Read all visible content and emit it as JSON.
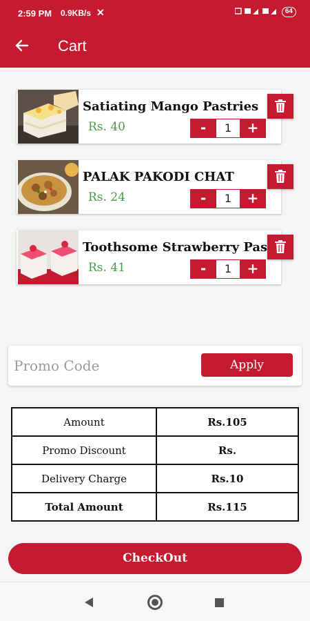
{
  "status_bar": {
    "time": "2:59 PM",
    "speed": "0.9KB/s",
    "battery": "64"
  },
  "app_bar": {
    "title": "Cart",
    "back_icon": "arrow-left-icon"
  },
  "cart": {
    "items": [
      {
        "name": "Satiating Mango Pastries",
        "price": "Rs. 40",
        "quantity": "1",
        "image": "mango-pastry-image"
      },
      {
        "name": "PALAK PAKODI CHAT",
        "price": "Rs. 24",
        "quantity": "1",
        "image": "palak-pakodi-image"
      },
      {
        "name": "Toothsome Strawberry Pastries",
        "price": "Rs. 41",
        "quantity": "1",
        "image": "strawberry-pastry-image"
      }
    ],
    "decrement_label": "-",
    "increment_label": "+",
    "delete_icon": "trash-icon"
  },
  "promo": {
    "placeholder": "Promo Code",
    "apply_label": "Apply"
  },
  "summary": {
    "rows": [
      {
        "label": "Amount",
        "value": "Rs.105"
      },
      {
        "label": "Promo Discount",
        "value": "Rs."
      },
      {
        "label": "Delivery Charge",
        "value": "Rs.10"
      },
      {
        "label": "Total Amount",
        "value": "Rs.115"
      }
    ]
  },
  "checkout_label": "CheckOut",
  "colors": {
    "primary": "#c51a2f",
    "price_green": "#4a9a4a",
    "background": "#f5f5f5"
  },
  "nav_icons": [
    "nav-back-icon",
    "nav-home-icon",
    "nav-recents-icon"
  ]
}
